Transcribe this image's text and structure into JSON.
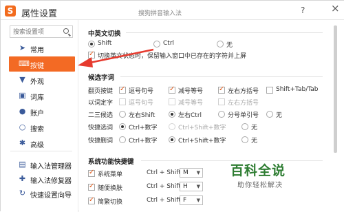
{
  "window": {
    "title": "属性设置",
    "subtitle": "搜狗拼音输入法",
    "help_label": "?",
    "close_label": "×",
    "logo_glyph": "S"
  },
  "sidebar": {
    "search_placeholder": "搜索设置项",
    "items": [
      {
        "label": "常用",
        "icon": "paper-plane-icon"
      },
      {
        "label": "按键",
        "icon": "keyboard-icon"
      },
      {
        "label": "外观",
        "icon": "shirt-icon"
      },
      {
        "label": "词库",
        "icon": "dictionary-icon"
      },
      {
        "label": "账户",
        "icon": "user-icon"
      },
      {
        "label": "搜索",
        "icon": "search-icon"
      },
      {
        "label": "高级",
        "icon": "gear-icon"
      }
    ],
    "tools": [
      {
        "label": "输入法管理器",
        "icon": "manager-icon"
      },
      {
        "label": "输入法修复器",
        "icon": "repair-icon"
      },
      {
        "label": "快速设置向导",
        "icon": "wizard-icon"
      }
    ],
    "accent": "#f36a24"
  },
  "sections": {
    "cn_en": {
      "title": "中英文切换",
      "opt_shift": "Shift",
      "opt_ctrl": "Ctrl",
      "opt_none": "无",
      "keep_label": "切换英文状态时，保留输入窗口中已存在的字符并上屏"
    },
    "candidates": {
      "title": "候选字词",
      "page_key": "翻页按键",
      "comma_period": "逗号句号",
      "minus_equal": "减号等号",
      "brackets": "左右方括号",
      "shift_tab": "Shift+Tab/Tab",
      "word_select": "以词定字",
      "row23": "二三候选",
      "left_shift": "左右Shift",
      "left_ctrl": "左右Ctrl",
      "semicolon": "分号单引号",
      "none": "无",
      "quick_select": "快捷选词",
      "ctrl_num": "Ctrl+数字",
      "ctrl_shift_num": "Ctrl+Shift+数字",
      "quick_delete": "快捷删词"
    },
    "shortcuts": {
      "title": "系统功能快捷键",
      "rows": [
        {
          "label": "系统菜单",
          "combo": "Ctrl + Shift +",
          "key": "M"
        },
        {
          "label": "随便换肤",
          "combo": "Ctrl + Shift +",
          "key": "H"
        },
        {
          "label": "简繁切换",
          "combo": "Ctrl + Shift +",
          "key": "F"
        }
      ]
    }
  },
  "watermark": {
    "main": "百科全说",
    "sub": "助你轻松解决"
  }
}
